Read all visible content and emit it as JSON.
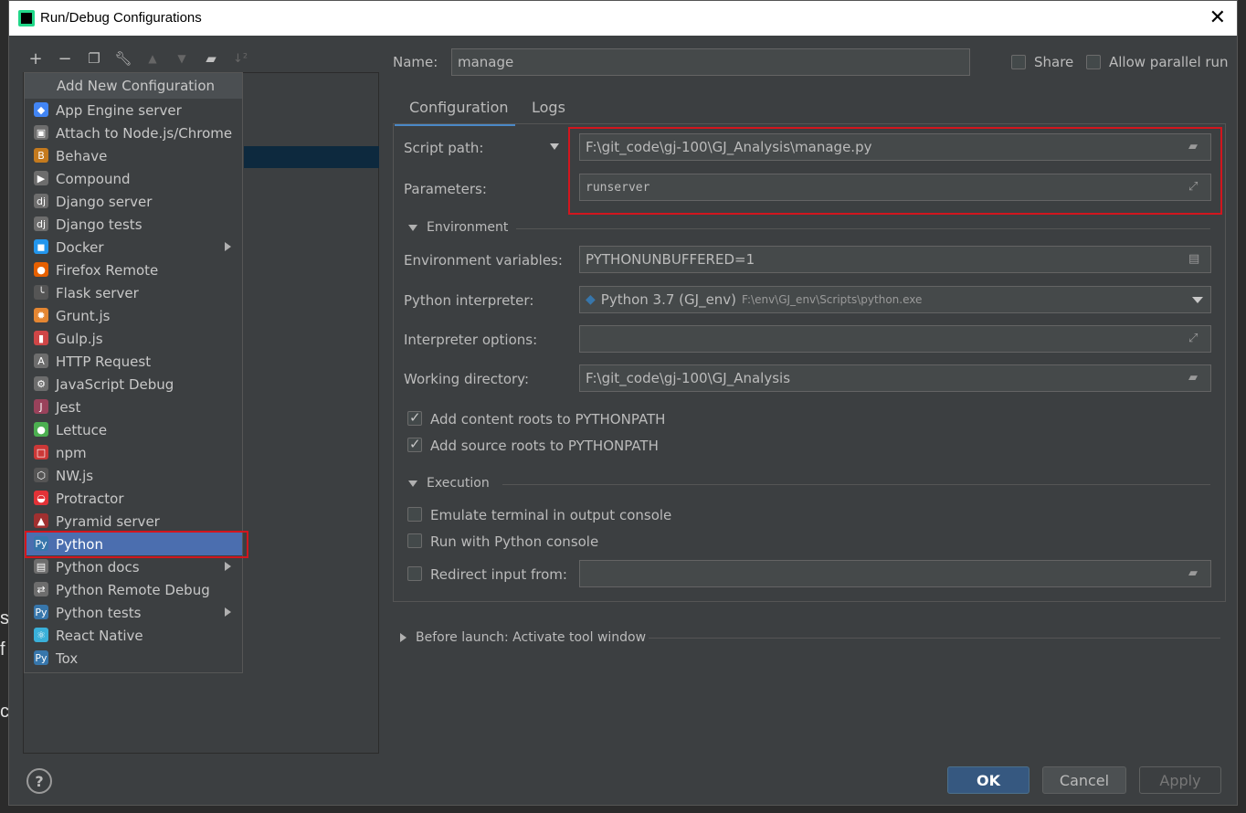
{
  "window": {
    "title": "Run/Debug Configurations"
  },
  "toolbar": {
    "icons": [
      "add-icon",
      "remove-icon",
      "copy-icon",
      "wrench-icon",
      "move-up-icon",
      "move-down-icon",
      "folder-icon",
      "sort-icon"
    ]
  },
  "popup": {
    "header": "Add New Configuration",
    "items": [
      {
        "label": "App Engine server",
        "icon": "app-engine-icon",
        "color": "#4285f4",
        "glyph": "◆",
        "submenu": false
      },
      {
        "label": "Attach to Node.js/Chrome",
        "icon": "nodejs-icon",
        "color": "#6d6d6d",
        "glyph": "▣",
        "submenu": false
      },
      {
        "label": "Behave",
        "icon": "behave-icon",
        "color": "#c47a1e",
        "glyph": "B",
        "submenu": false
      },
      {
        "label": "Compound",
        "icon": "compound-icon",
        "color": "#6d6d6d",
        "glyph": "▶",
        "submenu": false
      },
      {
        "label": "Django server",
        "icon": "django-icon",
        "color": "#6d6d6d",
        "glyph": "dj",
        "submenu": false
      },
      {
        "label": "Django tests",
        "icon": "django-tests-icon",
        "color": "#6d6d6d",
        "glyph": "dj",
        "submenu": false
      },
      {
        "label": "Docker",
        "icon": "docker-icon",
        "color": "#2396ed",
        "glyph": "◼",
        "submenu": true
      },
      {
        "label": "Firefox Remote",
        "icon": "firefox-icon",
        "color": "#e66000",
        "glyph": "●",
        "submenu": false
      },
      {
        "label": "Flask server",
        "icon": "flask-icon",
        "color": "#555555",
        "glyph": "╰",
        "submenu": false
      },
      {
        "label": "Grunt.js",
        "icon": "grunt-icon",
        "color": "#e48632",
        "glyph": "✹",
        "submenu": false
      },
      {
        "label": "Gulp.js",
        "icon": "gulp-icon",
        "color": "#cf4647",
        "glyph": "▮",
        "submenu": false
      },
      {
        "label": "HTTP Request",
        "icon": "http-request-icon",
        "color": "#6d6d6d",
        "glyph": "A",
        "submenu": false
      },
      {
        "label": "JavaScript Debug",
        "icon": "js-debug-icon",
        "color": "#6d6d6d",
        "glyph": "⚙",
        "submenu": false
      },
      {
        "label": "Jest",
        "icon": "jest-icon",
        "color": "#99425b",
        "glyph": "J",
        "submenu": false
      },
      {
        "label": "Lettuce",
        "icon": "lettuce-icon",
        "color": "#4caf50",
        "glyph": "●",
        "submenu": false
      },
      {
        "label": "npm",
        "icon": "npm-icon",
        "color": "#cb3837",
        "glyph": "□",
        "submenu": false
      },
      {
        "label": "NW.js",
        "icon": "nwjs-icon",
        "color": "#555555",
        "glyph": "⬡",
        "submenu": false
      },
      {
        "label": "Protractor",
        "icon": "protractor-icon",
        "color": "#e23237",
        "glyph": "◒",
        "submenu": false
      },
      {
        "label": "Pyramid server",
        "icon": "pyramid-icon",
        "color": "#a03030",
        "glyph": "▲",
        "submenu": false
      },
      {
        "label": "Python",
        "icon": "python-icon",
        "color": "#3776ab",
        "glyph": "Py",
        "submenu": false
      },
      {
        "label": "Python docs",
        "icon": "python-docs-icon",
        "color": "#6d6d6d",
        "glyph": "▤",
        "submenu": true
      },
      {
        "label": "Python Remote Debug",
        "icon": "python-remote-debug-icon",
        "color": "#6d6d6d",
        "glyph": "⇄",
        "submenu": false
      },
      {
        "label": "Python tests",
        "icon": "python-tests-icon",
        "color": "#3776ab",
        "glyph": "Py",
        "submenu": true
      },
      {
        "label": "React Native",
        "icon": "react-icon",
        "color": "#3ab0d9",
        "glyph": "⚛",
        "submenu": false
      },
      {
        "label": "Tox",
        "icon": "tox-icon",
        "color": "#3776ab",
        "glyph": "Py",
        "submenu": false
      }
    ],
    "selected_index": 19
  },
  "name": {
    "label": "Name:",
    "value": "manage"
  },
  "share": {
    "label": "Share",
    "checked": false
  },
  "parallel": {
    "label": "Allow parallel run",
    "checked": false
  },
  "tabs": [
    {
      "label": "Configuration",
      "active": true
    },
    {
      "label": "Logs",
      "active": false
    }
  ],
  "config": {
    "script_path": {
      "label": "Script path:",
      "value": "F:\\git_code\\gj-100\\GJ_Analysis\\manage.py"
    },
    "parameters": {
      "label": "Parameters:",
      "value": "runserver"
    },
    "environment": {
      "title": "Environment",
      "env_vars": {
        "label": "Environment variables:",
        "value": "PYTHONUNBUFFERED=1"
      },
      "interpreter": {
        "label": "Python interpreter:",
        "value": "Python 3.7 (GJ_env)",
        "path": "F:\\env\\GJ_env\\Scripts\\python.exe"
      },
      "interpreter_options": {
        "label": "Interpreter options:",
        "value": ""
      },
      "working_dir": {
        "label": "Working directory:",
        "value": "F:\\git_code\\gj-100\\GJ_Analysis"
      },
      "content_roots": {
        "label": "Add content roots to PYTHONPATH",
        "checked": true
      },
      "source_roots": {
        "label": "Add source roots to PYTHONPATH",
        "checked": true
      }
    },
    "execution": {
      "title": "Execution",
      "emulate_terminal": {
        "label": "Emulate terminal in output console",
        "checked": false
      },
      "python_console": {
        "label": "Run with Python console",
        "checked": false
      },
      "redirect_input": {
        "label": "Redirect input from:",
        "checked": false,
        "value": ""
      }
    },
    "before_launch": "Before launch: Activate tool window"
  },
  "buttons": {
    "ok": "OK",
    "cancel": "Cancel",
    "apply": "Apply",
    "help": "?"
  },
  "background_chars": [
    "s",
    "f",
    "c"
  ],
  "colors": {
    "accent": "#4b6eaf",
    "highlight_red": "#d2161e",
    "panel_bg": "#3c3f41"
  }
}
